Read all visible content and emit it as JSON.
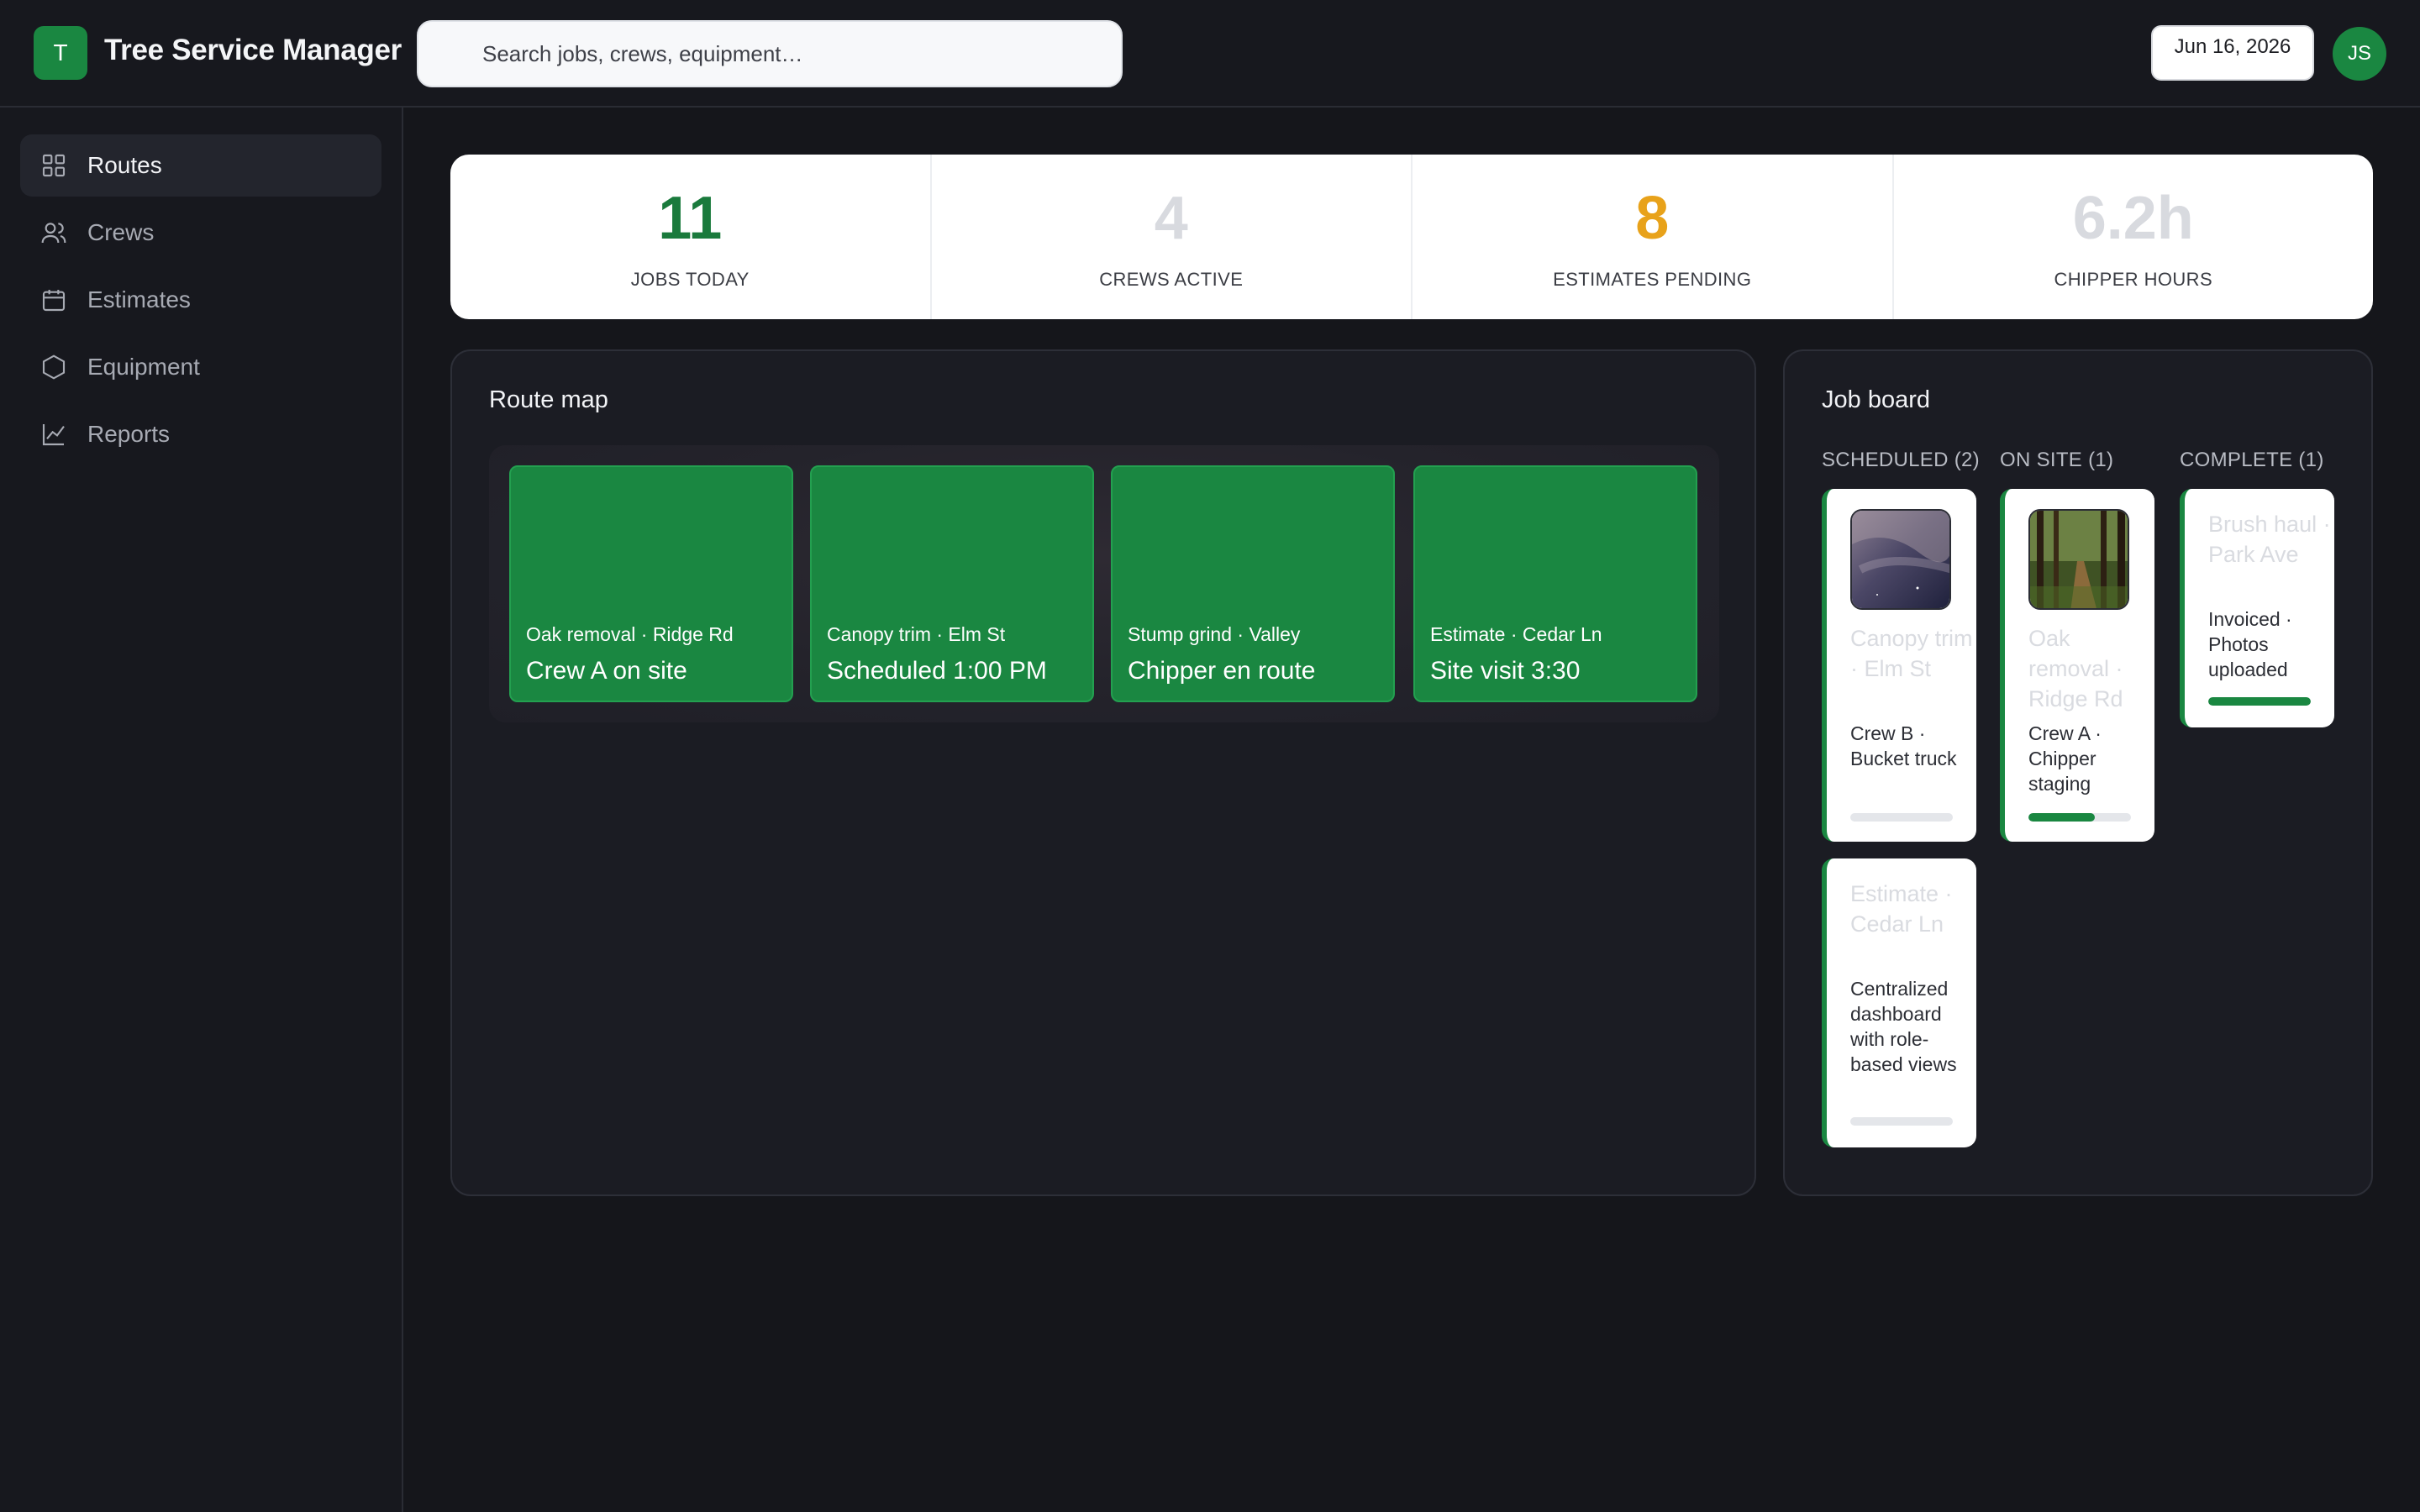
{
  "app": {
    "logo_letter": "T",
    "title": "Tree Service Manager"
  },
  "search": {
    "placeholder": "Search jobs, crews, equipment…"
  },
  "header": {
    "date": "Jun 16, 2026",
    "avatar_initials": "JS"
  },
  "sidebar": {
    "items": [
      {
        "label": "Routes",
        "icon": "grid-icon",
        "active": true
      },
      {
        "label": "Crews",
        "icon": "users-icon",
        "active": false
      },
      {
        "label": "Estimates",
        "icon": "calendar-icon",
        "active": false
      },
      {
        "label": "Equipment",
        "icon": "hexagon-icon",
        "active": false
      },
      {
        "label": "Reports",
        "icon": "chart-line-icon",
        "active": false
      }
    ]
  },
  "stats": [
    {
      "value": "11",
      "label": "JOBS TODAY",
      "color": "#1a7a3c"
    },
    {
      "value": "4",
      "label": "CREWS ACTIVE",
      "color": "#d8dadf"
    },
    {
      "value": "8",
      "label": "ESTIMATES PENDING",
      "color": "#e8a21a"
    },
    {
      "value": "6.2h",
      "label": "CHIPPER HOURS",
      "color": "#d8dadf"
    }
  ],
  "route_map": {
    "title": "Route map",
    "cards": [
      {
        "sub": "Oak removal · Ridge Rd",
        "main": "Crew A on site"
      },
      {
        "sub": "Canopy trim · Elm St",
        "main": "Scheduled 1:00 PM"
      },
      {
        "sub": "Stump grind · Valley",
        "main": "Chipper en route"
      },
      {
        "sub": "Estimate · Cedar Ln",
        "main": "Site visit 3:30"
      }
    ]
  },
  "job_board": {
    "title": "Job board",
    "columns": [
      {
        "heading": "SCHEDULED (2)"
      },
      {
        "heading": "ON SITE (1)"
      },
      {
        "heading": "COMPLETE (1)"
      }
    ],
    "cards": [
      {
        "title": "Canopy trim · Elm St",
        "desc": "Crew B · Bucket truck",
        "progress": 0.0,
        "thumb": "night-sky-thumbnail"
      },
      {
        "title": "Estimate · Cedar Ln",
        "desc": "Centralized dashboard with role-based views",
        "progress": 0.0
      },
      {
        "title": "Oak removal · Ridge Rd",
        "desc": "Crew A · Chipper staging",
        "progress": 0.65,
        "thumb": "forest-path-thumbnail"
      },
      {
        "title": "Brush haul · Park Ave",
        "desc": "Invoiced · Photos uploaded",
        "progress": 1.0
      }
    ]
  },
  "colors": {
    "accent": "#1a8741",
    "background": "#15161b",
    "panel": "#1b1c23"
  }
}
